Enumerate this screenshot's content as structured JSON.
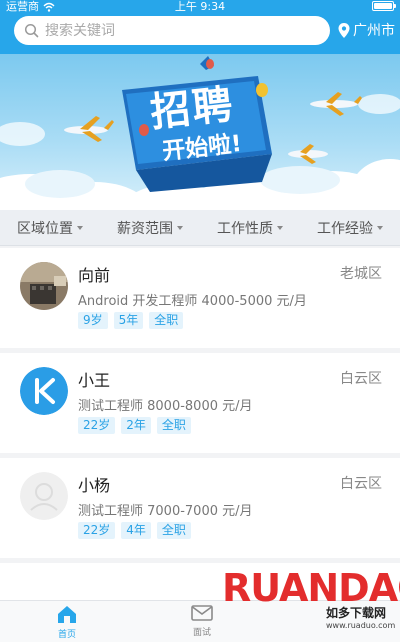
{
  "status_bar": {
    "carrier": "运营商",
    "time": "上午 9:34"
  },
  "search": {
    "placeholder": "搜索关键词"
  },
  "location": {
    "city": "广州市"
  },
  "banner": {
    "title_big": "招聘",
    "title_small": "开始啦!"
  },
  "filters": [
    {
      "label": "区域位置"
    },
    {
      "label": "薪资范围"
    },
    {
      "label": "工作性质"
    },
    {
      "label": "工作经验"
    }
  ],
  "candidates": [
    {
      "name": "向前",
      "district": "老城区",
      "job": "Android 开发工程师 4000-5000 元/月",
      "tags": [
        "9岁",
        "5年",
        "全职"
      ]
    },
    {
      "name": "小王",
      "district": "白云区",
      "job": "测试工程师 8000-8000 元/月",
      "tags": [
        "22岁",
        "2年",
        "全职"
      ]
    },
    {
      "name": "小杨",
      "district": "白云区",
      "job": "测试工程师 7000-7000 元/月",
      "tags": [
        "22岁",
        "4年",
        "全职"
      ]
    }
  ],
  "tabbar": {
    "home": "首页",
    "interview": "面试"
  },
  "watermark": {
    "brand": "RUANDAO",
    "cn": "如多下载网",
    "url": "www.ruaduo.com"
  },
  "colors": {
    "primary": "#27a6ea",
    "tag_bg": "#e4f3fc",
    "tag_text": "#2aa2e5"
  }
}
